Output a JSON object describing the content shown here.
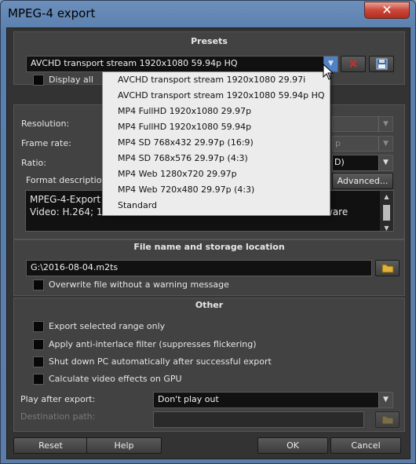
{
  "window": {
    "title": "MPEG-4 export",
    "close_label": "✕"
  },
  "presets": {
    "heading": "Presets",
    "selected": "AVCHD transport stream 1920x1080 59.94p HQ",
    "display_all_label": "Display all",
    "dropdown_items": [
      "AVCHD transport stream 1920x1080 29.97i",
      "AVCHD transport stream 1920x1080 59.94p HQ",
      "MP4 FullHD 1920x1080 29.97p",
      "MP4 FullHD 1920x1080 59.94p",
      "MP4 SD 768x432 29.97p (16:9)",
      "MP4 SD 768x576 29.97p (4:3)",
      "MP4 Web 1280x720 29.97p",
      "MP4 Web 720x480 29.97p (4:3)",
      "Standard"
    ]
  },
  "settings": {
    "resolution_label": "Resolution:",
    "frame_rate_label": "Frame rate:",
    "frame_rate_partial": "p",
    "ratio_label": "Ratio:",
    "ratio_partial": "D)",
    "format_description_label": "Format description",
    "advanced_label": "Advanced...",
    "description_line1": "MPEG-4-Export",
    "description_line2": "Video: H.264; 19",
    "description_line2_end": "ware"
  },
  "file": {
    "heading": "File name and storage location",
    "path": "G:\\2016-08-04.m2ts",
    "overwrite_label": "Overwrite file without a warning message"
  },
  "other": {
    "heading": "Other",
    "options": [
      "Export selected range only",
      "Apply anti-interlace filter (suppresses flickering)",
      "Shut down PC automatically after successful export",
      "Calculate video effects on GPU"
    ],
    "play_after_label": "Play after export:",
    "play_after_value": "Don't play out",
    "destination_label": "Destination path:"
  },
  "buttons": {
    "reset": "Reset",
    "help": "Help",
    "ok": "OK",
    "cancel": "Cancel"
  }
}
